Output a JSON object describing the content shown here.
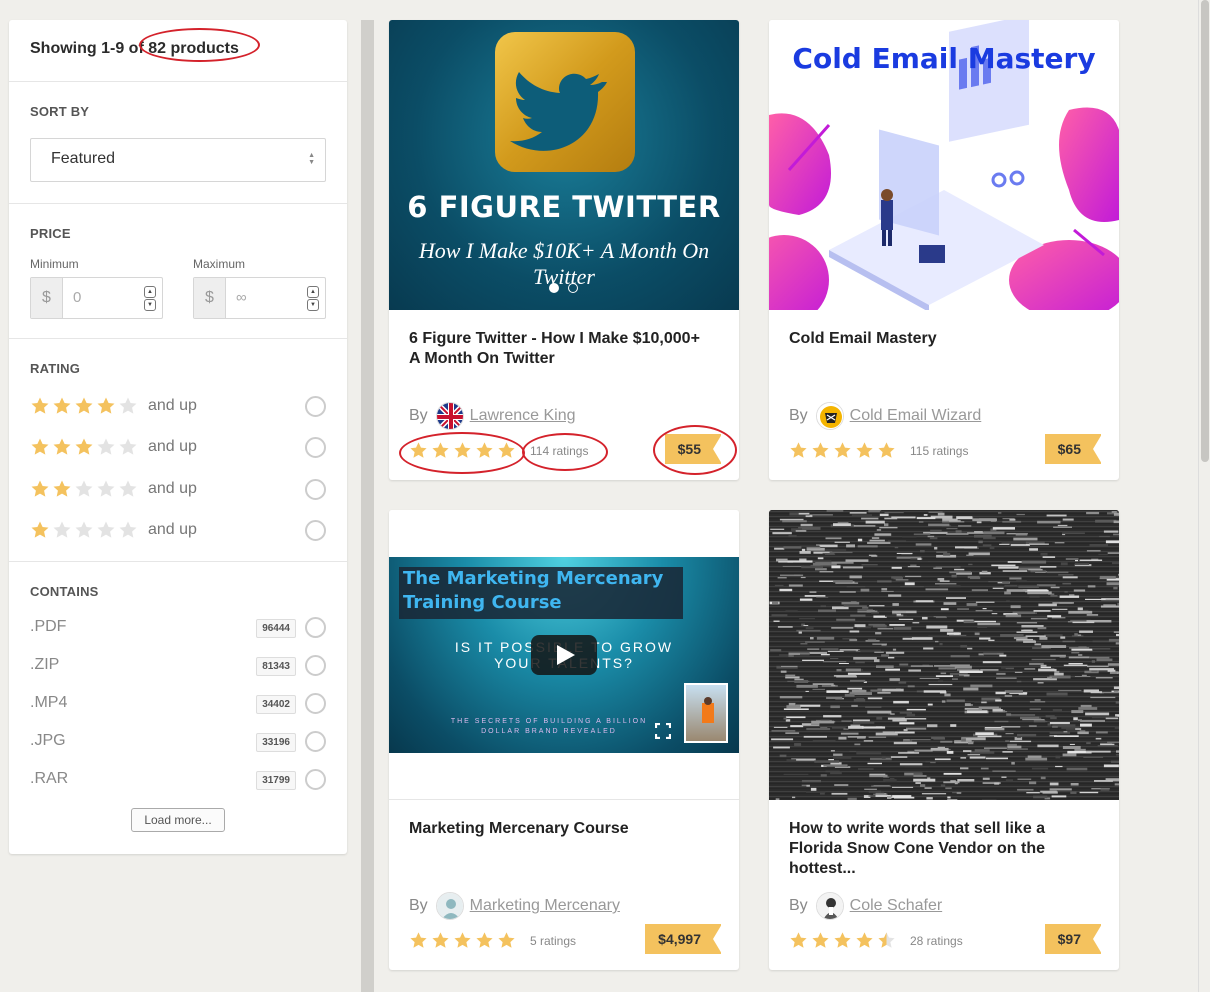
{
  "summary": {
    "prefix": "Showing 1-9 of ",
    "count": "82 products"
  },
  "sort": {
    "title": "SORT BY",
    "selected": "Featured"
  },
  "price": {
    "title": "PRICE",
    "min_label": "Minimum",
    "max_label": "Maximum",
    "currency": "$",
    "min_placeholder": "0",
    "max_placeholder": "∞"
  },
  "rating": {
    "title": "RATING",
    "options": [
      {
        "stars": 4,
        "label": "and up"
      },
      {
        "stars": 3,
        "label": "and up"
      },
      {
        "stars": 2,
        "label": "and up"
      },
      {
        "stars": 1,
        "label": "and up"
      }
    ]
  },
  "contains": {
    "title": "CONTAINS",
    "items": [
      {
        "ext": ".PDF",
        "count": "96444"
      },
      {
        "ext": ".ZIP",
        "count": "81343"
      },
      {
        "ext": ".MP4",
        "count": "34402"
      },
      {
        "ext": ".JPG",
        "count": "33196"
      },
      {
        "ext": ".RAR",
        "count": "31799"
      }
    ],
    "load_more": "Load more..."
  },
  "products": [
    {
      "title": "6 Figure Twitter - How I Make $10,000+ A Month On Twitter",
      "by": "By",
      "author": "Lawrence King",
      "rating": 5,
      "ratings_text": "114 ratings",
      "price": "$55",
      "thumb": {
        "headline": "6 FIGURE TWITTER",
        "subline": "How I Make $10K+ A Month On Twitter"
      }
    },
    {
      "title": "Cold Email Mastery",
      "by": "By",
      "author": "Cold Email Wizard",
      "rating": 5,
      "ratings_text": "115 ratings",
      "price": "$65",
      "thumb": {
        "headline": "Cold Email Mastery"
      }
    },
    {
      "title": "Marketing Mercenary Course",
      "by": "By",
      "author": "Marketing Mercenary",
      "rating": 5,
      "ratings_text": "5 ratings",
      "price": "$4,997",
      "thumb": {
        "headline": "The Marketing Mercenary Training Course",
        "question": "IS IT POSSIBLE TO GROW YOUR TALENTS?",
        "tagline": "THE SECRETS OF BUILDING A BILLION DOLLAR BRAND REVEALED"
      }
    },
    {
      "title": "How to write words that sell like a Florida Snow Cone Vendor on the hottest...",
      "by": "By",
      "author": "Cole Schafer",
      "rating": 4.5,
      "ratings_text": "28 ratings",
      "price": "$97"
    }
  ],
  "colors": {
    "star": "#f4c25e",
    "star_empty": "#e3e3e3",
    "price_tag": "#f4c25e",
    "annotation": "#d4222b"
  }
}
